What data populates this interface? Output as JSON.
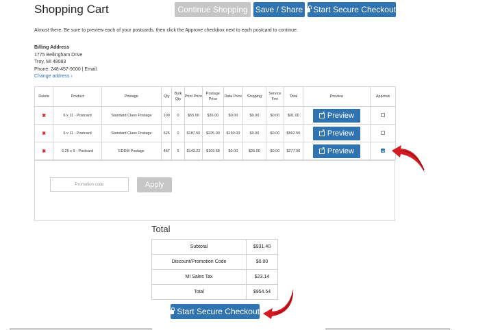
{
  "header": {
    "title": "Shopping Cart",
    "continue_label": "Continue Shopping",
    "save_share_label": "Save / Share",
    "checkout_label": "Start Secure Checkout"
  },
  "instructions": "Almost there. Be sure to preview each of your postcards, then click the Approve checkbox next to each postcard to continue.",
  "billing": {
    "heading": "Billing Address",
    "street": "1775 Bellingham Drive",
    "city": "Troy, MI 48083",
    "phone": "Phone: 248-457-9000 | Email:",
    "change_link": "Change address ›"
  },
  "cart": {
    "columns": [
      "Delete",
      "Product",
      "Postage",
      "Qty",
      "Bulk Qty",
      "Print Price",
      "Postage Price",
      "Data Price",
      "Shipping",
      "Service Fee",
      "Total",
      "Preview",
      "Approve"
    ],
    "rows": [
      {
        "delete": "✖",
        "product": "6 x 11 - Postcard",
        "postage": "Standard Class Postage",
        "qty": "100",
        "bulk_qty": "0",
        "print_price": "$55.00",
        "postage_price": "$36.00",
        "data_price": "$0.00",
        "shipping": "$0.00",
        "service_fee": "$0.00",
        "total": "$91.00",
        "preview": "Preview",
        "approved": false
      },
      {
        "delete": "✖",
        "product": "6 x 11 - Postcard",
        "postage": "Standard Class Postage",
        "qty": "625",
        "bulk_qty": "0",
        "print_price": "$187.50",
        "postage_price": "$225.00",
        "data_price": "$150.00",
        "shipping": "$0.00",
        "service_fee": "$0.00",
        "total": "$562.50",
        "preview": "Preview",
        "approved": false
      },
      {
        "delete": "✖",
        "product": "6.25 x 9 - Postcard",
        "postage": "EDDM Postage",
        "qty": "457",
        "bulk_qty": "5",
        "print_price": "$143.22",
        "postage_price": "$109.68",
        "data_price": "$0.00",
        "shipping": "$25.00",
        "service_fee": "$0.00",
        "total": "$277.90",
        "preview": "Preview",
        "approved": true
      }
    ]
  },
  "promo": {
    "placeholder": "Promotion code",
    "apply_label": "Apply"
  },
  "totals": {
    "heading": "Total",
    "rows": [
      {
        "label": "Subtotal",
        "value": "$931.40"
      },
      {
        "label": "Discount/Promotion Code",
        "value": "$0.00"
      },
      {
        "label": "MI Sales Tax",
        "value": "$23.14"
      },
      {
        "label": "Total",
        "value": "$954.54"
      }
    ]
  },
  "footer": {
    "checkout_label": "Start Secure Checkout"
  },
  "colors": {
    "primary": "#2f73b1",
    "disabled": "#c6c6c6",
    "delete": "#d9232e",
    "annotation_arrow": "#d41a22"
  },
  "icons": [
    "lock-icon",
    "external-link-icon",
    "delete-x-icon",
    "red-curved-arrow-icon"
  ]
}
